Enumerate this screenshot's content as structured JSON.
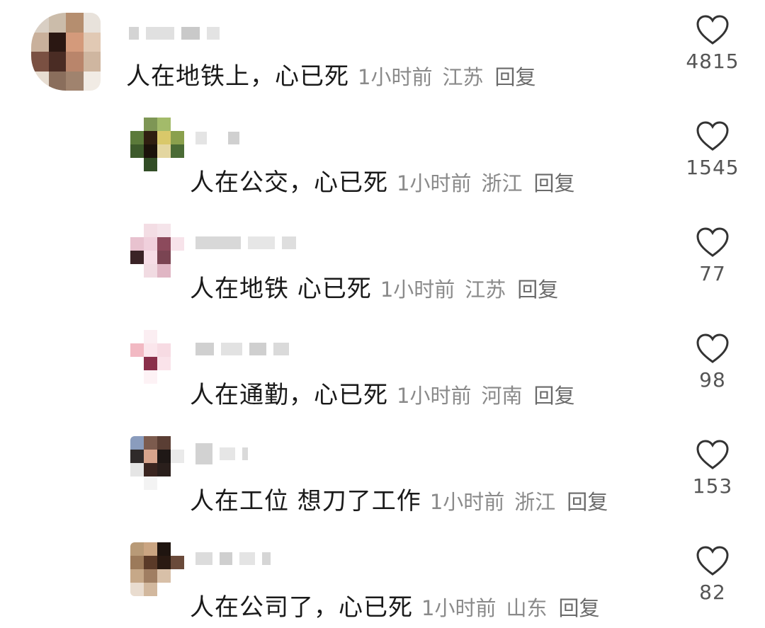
{
  "colors": {
    "text": "#1a1a1a",
    "meta": "#8a8a8a",
    "reply": "#6a6a6a",
    "heart_outline": "#333333"
  },
  "icons": {
    "like": "heart-outline-icon"
  },
  "comments": [
    {
      "text": "人在地铁上，心已死",
      "time": "1小时前",
      "location": "江苏",
      "reply_label": "回复",
      "likes": "4815"
    },
    {
      "text": "人在公交，心已死",
      "time": "1小时前",
      "location": "浙江",
      "reply_label": "回复",
      "likes": "1545"
    },
    {
      "text": "人在地铁 心已死",
      "time": "1小时前",
      "location": "江苏",
      "reply_label": "回复",
      "likes": "77"
    },
    {
      "text": "人在通勤，心已死",
      "time": "1小时前",
      "location": "河南",
      "reply_label": "回复",
      "likes": "98"
    },
    {
      "text": "人在工位 想刀了工作",
      "time": "1小时前",
      "location": "浙江",
      "reply_label": "回复",
      "likes": "153"
    },
    {
      "text": "人在公司了，心已死",
      "time": "1小时前",
      "location": "山东",
      "reply_label": "回复",
      "likes": "82"
    }
  ]
}
